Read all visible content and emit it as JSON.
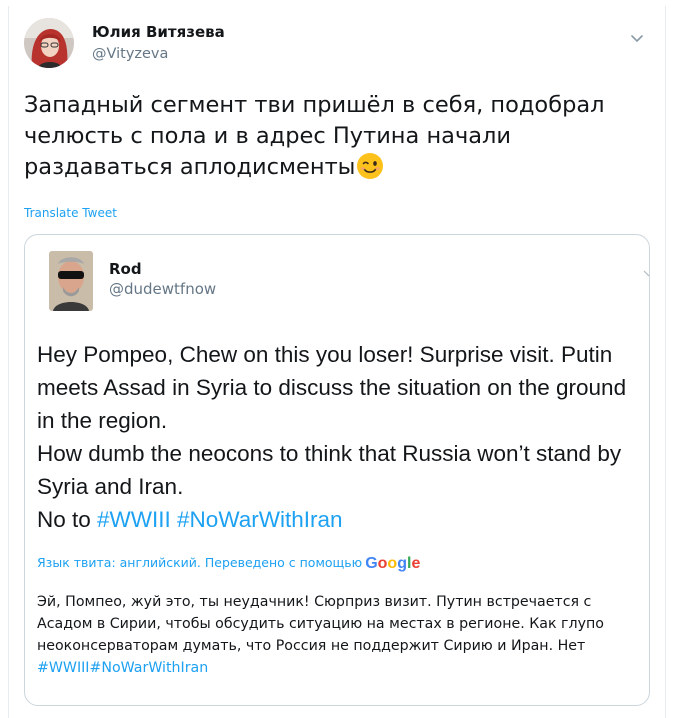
{
  "tweet": {
    "author_name": "Юлия Витязева",
    "author_handle": "@Vityzeva",
    "text": "Западный сегмент тви пришёл в себя, подобрал челюсть с пола и в адрес Путина начали раздаваться аплодисменты",
    "emoji": "winking-face",
    "translate_label": "Translate Tweet"
  },
  "quoted_tweet": {
    "author_name": "Rod",
    "author_handle": "@dudewtfnow",
    "lines": [
      "Hey Pompeo, Chew on this you loser! Surprise visit. Putin meets Assad in Syria to discuss the situation on the ground in the region.",
      "How dumb the neocons to think that Russia won’t stand by Syria and Iran."
    ],
    "last_line_prefix": "No to ",
    "hashtags": [
      "#WWIII",
      "#NoWarWithIran"
    ],
    "language_note": "Язык твита: английский. Переведено с помощью",
    "translation_provider": "Google",
    "translation_text": "Эй, Помпео, жуй это, ты неудачник! Сюрприз визит. Путин встречается с Асадом в Сирии, чтобы обсудить ситуацию на местах в регионе. Как глупо неоконсерваторам думать, что Россия не поддержит Сирию и Иран. Нет",
    "translation_hashtags": "#WWIII#NoWarWithIran"
  },
  "colors": {
    "link": "#1da1f2",
    "secondary_text": "#657786",
    "border": "#ccd6dd"
  }
}
